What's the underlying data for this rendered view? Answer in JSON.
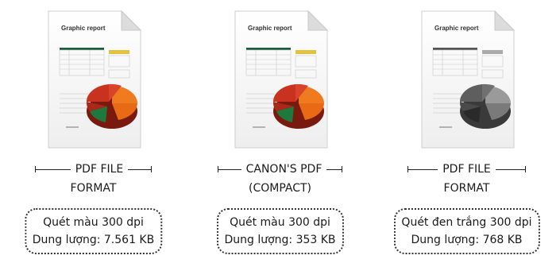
{
  "items": [
    {
      "doc_title": "Graphic report",
      "chart_style": "color",
      "caption_line1": "PDF FILE",
      "caption_line2": "FORMAT",
      "scan": "Quét màu 300 dpi",
      "size": "Dung lượng: 7.561 KB"
    },
    {
      "doc_title": "Graphic report",
      "chart_style": "color",
      "caption_line1": "CANON'S PDF",
      "caption_line2": "(COMPACT)",
      "scan": "Quét màu 300 dpi",
      "size": "Dung lượng: 353 KB"
    },
    {
      "doc_title": "Graphic report",
      "chart_style": "grayscale",
      "caption_line1": "PDF FILE",
      "caption_line2": "FORMAT",
      "scan": "Quét đen trắng 300 dpi",
      "size": "Dung lượng: 768 KB"
    }
  ],
  "colors": {
    "pie_red": "#c8321e",
    "pie_orange": "#f07a1e",
    "pie_green": "#1e7a3c",
    "table_header": "#1e5a3c",
    "accent_tag": "#e6c23c"
  }
}
